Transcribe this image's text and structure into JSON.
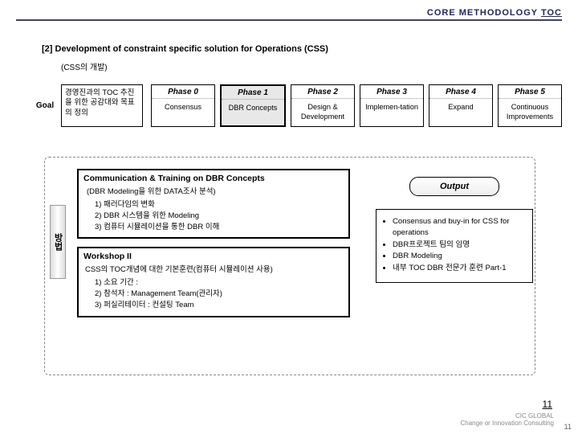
{
  "header": {
    "title": "CORE METHODOLOGY",
    "toc": "TOC"
  },
  "section": {
    "title": "[2] Development of constraint specific solution for Operations (CSS)",
    "subtitle": "(CSS의 개발)"
  },
  "goal": {
    "label": "Goal",
    "desc": "경영진과의 TOC 추진을 위한 공감대와 목표의 정의"
  },
  "phases": [
    {
      "title": "Phase 0",
      "body": "Consensus"
    },
    {
      "title": "Phase 1",
      "body": "DBR Concepts"
    },
    {
      "title": "Phase 2",
      "body": "Design & Development"
    },
    {
      "title": "Phase 3",
      "body": "Implemen-tation"
    },
    {
      "title": "Phase 4",
      "body": "Expand"
    },
    {
      "title": "Phase 5",
      "body": "Continuous Improvements"
    }
  ],
  "method_label": "방법",
  "comm": {
    "title": "Communication & Training on DBR Concepts",
    "sub": "(DBR Modeling을 위한 DATA조사 분석)",
    "items": [
      "1) 패러다임의 변화",
      "2) DBR 시스템을 위한 Modeling",
      "3) 컴퓨터 시뮬레이션을 통한 DBR 이해"
    ]
  },
  "ws": {
    "title": "Workshop II",
    "sub": "CSS의 TOC개념에 대한 기본훈련(컴퓨터 시뮬레이션 사용)",
    "items": [
      "1) 소요 기간 :",
      "2) 참석자 : Management Team(관리자)",
      "3) 퍼실리테이터 : 컨설팅 Team"
    ]
  },
  "output": {
    "label": "Output",
    "items": [
      "Consensus and buy-in for CSS for operations",
      "DBR프로젝트 팀의 임명",
      "DBR Modeling",
      "내부 TOC DBR 전문가 훈련 Part-1"
    ]
  },
  "page": {
    "main": "11",
    "footer": "11",
    "logo_top": "CIC GLOBAL",
    "logo_sub": "Change or Innovation Consulting"
  }
}
